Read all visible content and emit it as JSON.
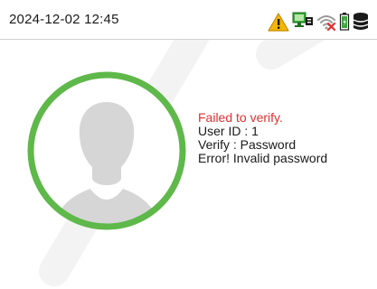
{
  "status_bar": {
    "datetime": "2024-12-02 12:45",
    "icons": [
      "warning-icon",
      "network-icon",
      "wifi-disconnected-icon",
      "battery-icon",
      "database-icon"
    ],
    "colors": {
      "warning": "#f2b705",
      "network": "#3aa63a",
      "wifi": "#9a9a9a",
      "wifi_x": "#e03030",
      "battery": "#3aa63a",
      "database": "#1a1a1a"
    }
  },
  "verification": {
    "status": "Failed to verify.",
    "user_id": "User ID : 1",
    "verify_mode": "Verify : Password",
    "error": "Error! Invalid password",
    "status_color": "#e03030"
  },
  "avatar": {
    "icon": "user-silhouette-icon",
    "ring_color": "#5fb84a"
  }
}
